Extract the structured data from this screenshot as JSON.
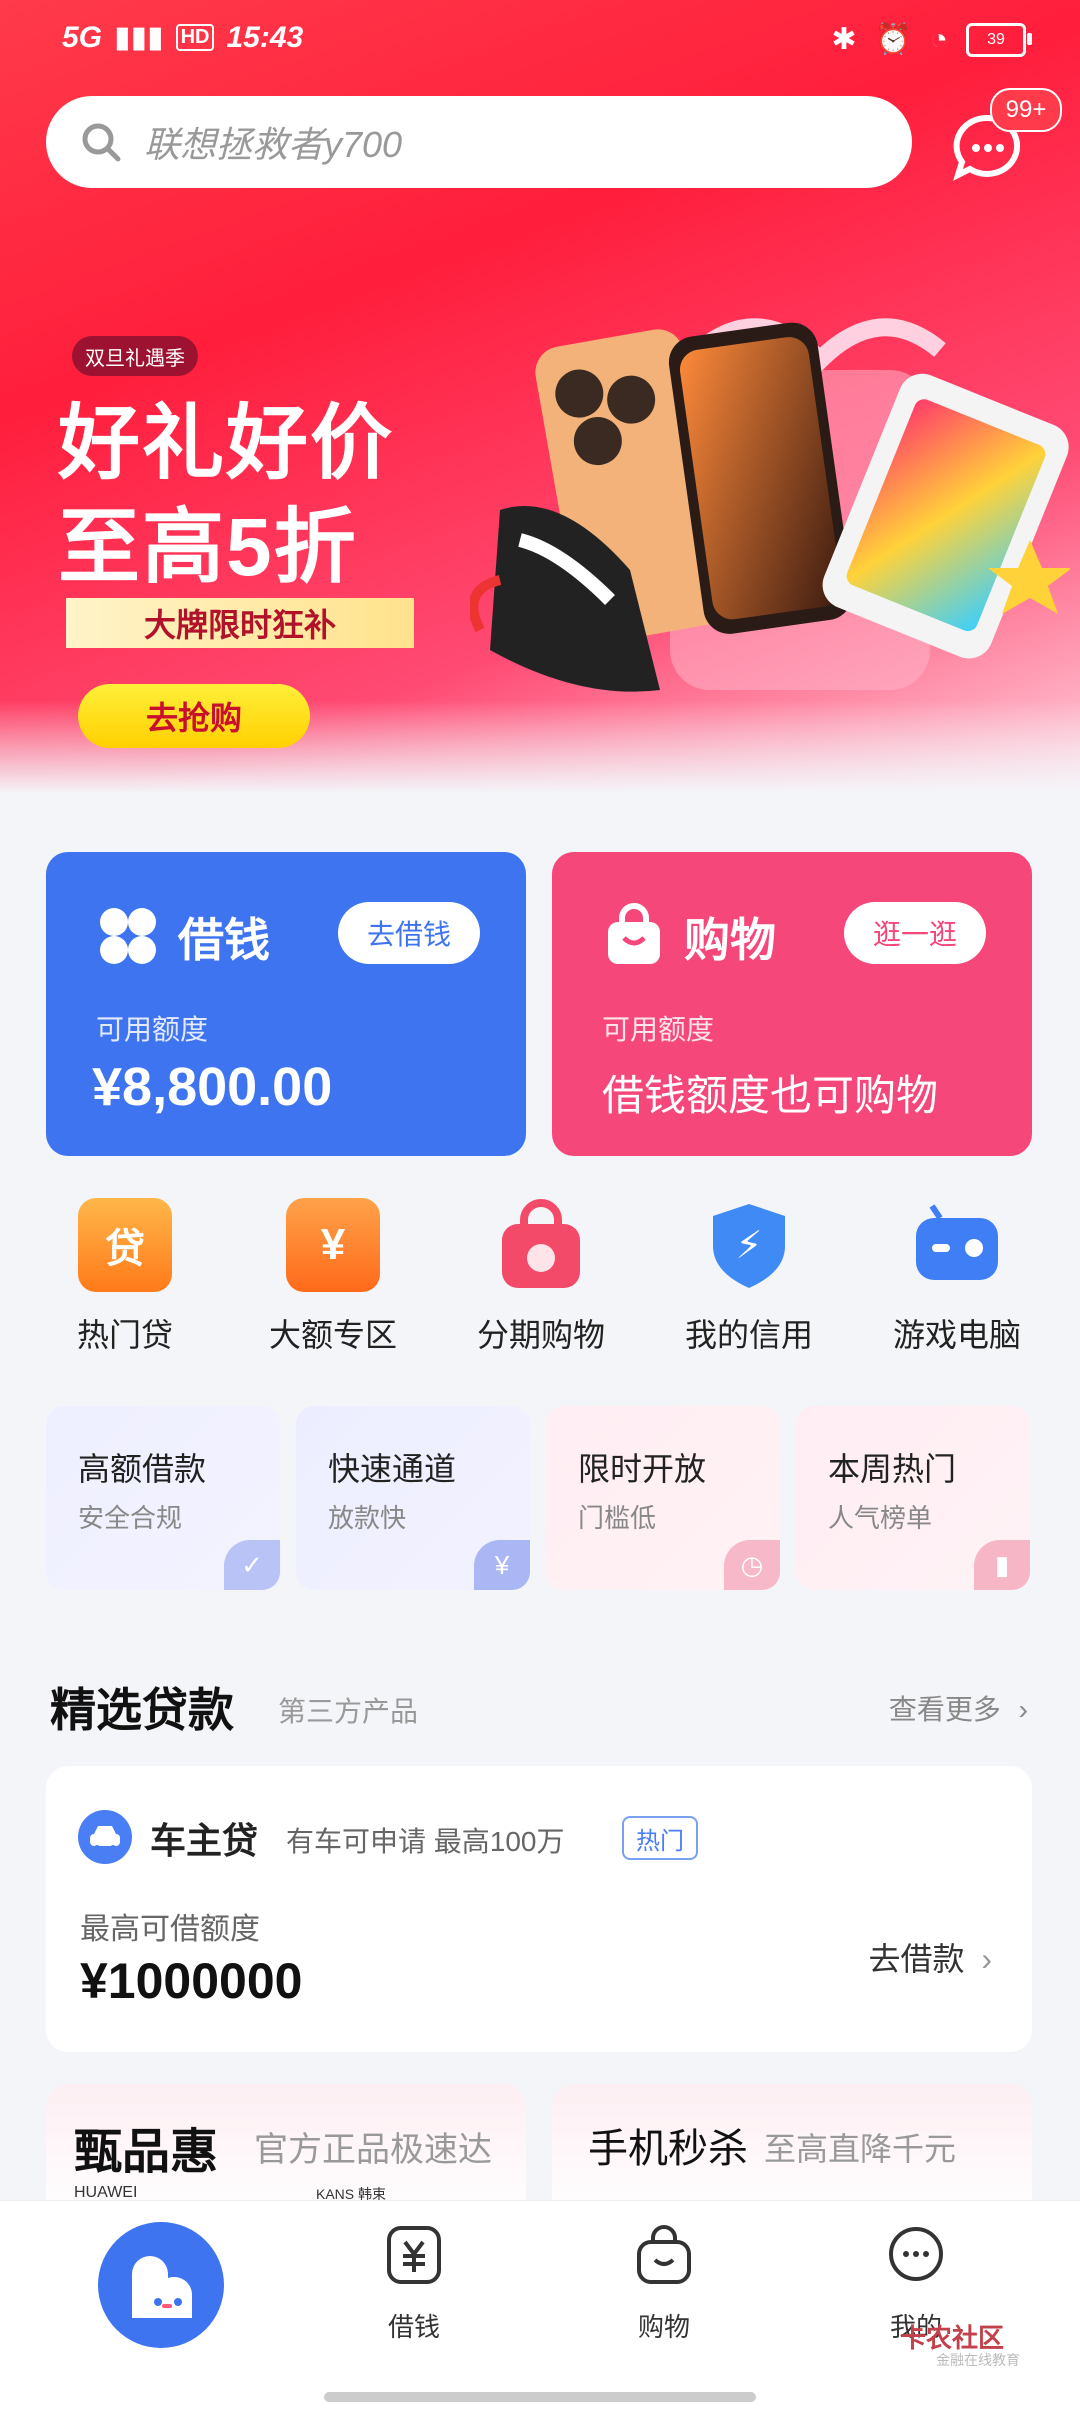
{
  "status_bar": {
    "network": "5G",
    "hd": "HD",
    "time": "15:43",
    "battery": "39"
  },
  "search": {
    "placeholder": "联想拯救者y700"
  },
  "messages": {
    "badge": "99+"
  },
  "banner": {
    "tag": "双旦礼遇季",
    "title_line1": "好礼好价",
    "title_line2": "至高5折",
    "subtitle": "大牌限时狂补",
    "button": "去抢购"
  },
  "cards": {
    "borrow": {
      "title": "借钱",
      "action": "去借钱",
      "label": "可用额度",
      "value": "¥8,800.00"
    },
    "shop": {
      "title": "购物",
      "action": "逛一逛",
      "label": "可用额度",
      "value": "借钱额度也可购物"
    }
  },
  "shortcuts": [
    {
      "label": "热门贷",
      "glyph": "贷"
    },
    {
      "label": "大额专区",
      "glyph": "¥"
    },
    {
      "label": "分期购物",
      "glyph": ""
    },
    {
      "label": "我的信用",
      "glyph": "⚡"
    },
    {
      "label": "游戏电脑",
      "glyph": ""
    }
  ],
  "features": [
    {
      "title": "高额借款",
      "subtitle": "安全合规",
      "glyph": "✓"
    },
    {
      "title": "快速通道",
      "subtitle": "放款快",
      "glyph": "¥"
    },
    {
      "title": "限时开放",
      "subtitle": "门槛低",
      "glyph": "◷"
    },
    {
      "title": "本周热门",
      "subtitle": "人气榜单",
      "glyph": "▮"
    }
  ],
  "section": {
    "title": "精选贷款",
    "subtitle": "第三方产品",
    "more": "查看更多"
  },
  "loan_item": {
    "name": "车主贷",
    "desc": "有车可申请 最高100万",
    "tag": "热门",
    "label": "最高可借额度",
    "amount": "¥1000000",
    "action": "去借款"
  },
  "promos": [
    {
      "title": "甄品惠",
      "subtitle": "官方正品极速达",
      "brand1": "HUAWEI",
      "brand2": "KANS 韩束"
    },
    {
      "title": "手机秒杀",
      "subtitle": "至高直降千元"
    }
  ],
  "tabbar": {
    "tab1": "借钱",
    "tab2": "购物",
    "tab3": "我的"
  },
  "watermark": {
    "title": "卡农社区",
    "subtitle": "金融在线教育"
  },
  "colors": {
    "brand_red": "#ff1e3c",
    "borrow_blue": "#3f74f1",
    "shop_pink": "#f5477a"
  }
}
